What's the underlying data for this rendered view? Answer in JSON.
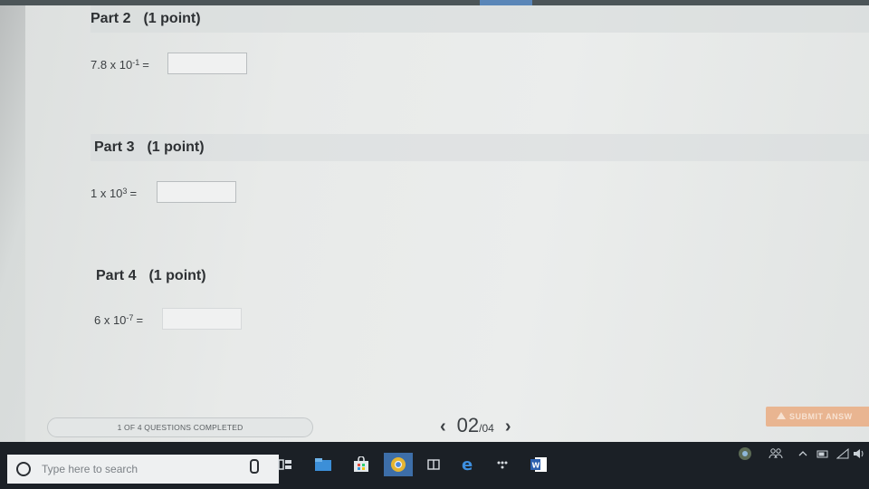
{
  "parts": [
    {
      "title": "Part 2",
      "points": "(1 point)",
      "base": "7.8 x 10",
      "exponent": "-1",
      "equals": "=",
      "answer_value": ""
    },
    {
      "title": "Part 3",
      "points": "(1 point)",
      "base": "1 x 10",
      "exponent": "3",
      "equals": "=",
      "answer_value": ""
    },
    {
      "title": "Part 4",
      "points": "(1 point)",
      "base": "6 x 10",
      "exponent": "-7",
      "equals": "=",
      "answer_value": ""
    }
  ],
  "footer": {
    "progress_text": "1 OF 4 QUESTIONS COMPLETED",
    "questions_completed": 1,
    "questions_total": 4,
    "prev_symbol": "‹",
    "next_symbol": "›",
    "current_page": "02",
    "total_pages": "/04",
    "submit_label": "SUBMIT ANSW"
  },
  "taskbar": {
    "search_placeholder": "Type here to search",
    "icons": [
      "cortana-mic-icon",
      "task-view-icon",
      "file-explorer-icon",
      "store-icon",
      "chrome-icon",
      "windows-app-icon",
      "edge-icon",
      "network-app-icon",
      "word-icon"
    ],
    "tray_icons": [
      "chrome-tray-icon",
      "people-icon",
      "show-hidden-icons-chevron",
      "battery-icon",
      "wifi-icon",
      "volume-icon"
    ]
  },
  "colors": {
    "submit_button": "#e9b591",
    "taskbar": "#1b2026",
    "page_background": "#e8eae9"
  }
}
